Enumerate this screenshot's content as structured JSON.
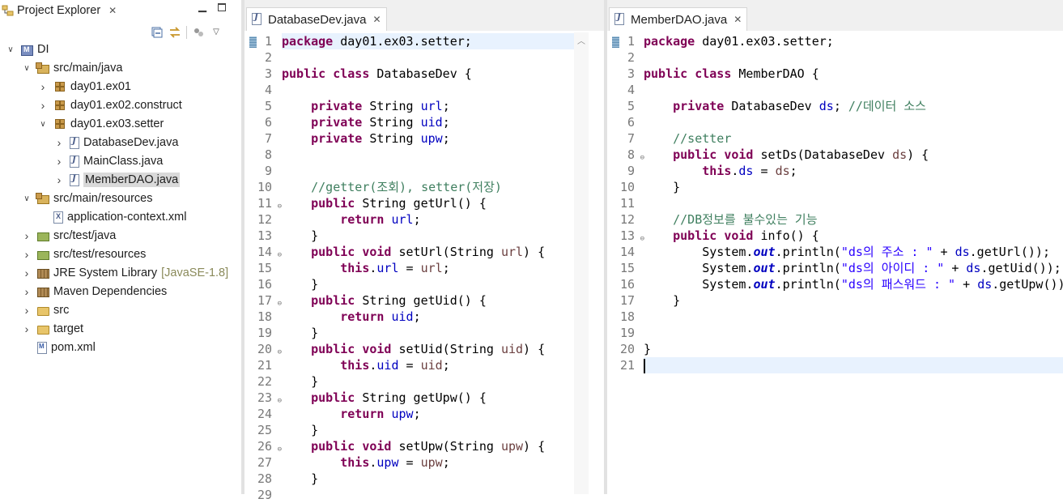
{
  "explorer": {
    "title": "Project Explorer",
    "tree": [
      {
        "label": "DI",
        "icon": "maven-project-icon",
        "twisty": "expanded",
        "level": 0
      },
      {
        "label": "src/main/java",
        "icon": "source-folder-icon",
        "twisty": "expanded",
        "level": 1
      },
      {
        "label": "day01.ex01",
        "icon": "package-icon",
        "twisty": "collapsed",
        "level": 2
      },
      {
        "label": "day01.ex02.construct",
        "icon": "package-icon",
        "twisty": "collapsed",
        "level": 2
      },
      {
        "label": "day01.ex03.setter",
        "icon": "package-icon",
        "twisty": "expanded",
        "level": 2
      },
      {
        "label": "DatabaseDev.java",
        "icon": "java-file-icon",
        "twisty": "collapsed",
        "level": 3
      },
      {
        "label": "MainClass.java",
        "icon": "java-file-icon",
        "twisty": "collapsed",
        "level": 3
      },
      {
        "label": "MemberDAO.java",
        "icon": "java-file-icon",
        "twisty": "collapsed",
        "level": 3,
        "selected": true
      },
      {
        "label": "src/main/resources",
        "icon": "source-folder-icon",
        "twisty": "expanded",
        "level": 1
      },
      {
        "label": "application-context.xml",
        "icon": "xml-file-icon",
        "twisty": "none",
        "level": 2
      },
      {
        "label": "src/test/java",
        "icon": "test-folder-icon",
        "twisty": "collapsed",
        "level": 1
      },
      {
        "label": "src/test/resources",
        "icon": "test-folder-icon",
        "twisty": "collapsed",
        "level": 1
      },
      {
        "label": "JRE System Library",
        "decoration": "[JavaSE-1.8]",
        "icon": "library-icon",
        "twisty": "collapsed",
        "level": 1
      },
      {
        "label": "Maven Dependencies",
        "icon": "library-icon",
        "twisty": "collapsed",
        "level": 1
      },
      {
        "label": "src",
        "icon": "folder-icon",
        "twisty": "collapsed",
        "level": 1
      },
      {
        "label": "target",
        "icon": "folder-icon",
        "twisty": "collapsed",
        "level": 1
      },
      {
        "label": "pom.xml",
        "icon": "maven-file-icon",
        "twisty": "none",
        "level": 1
      }
    ]
  },
  "editor1": {
    "tab_label": "DatabaseDev.java",
    "line_numbers": [
      "1",
      "2",
      "3",
      "4",
      "5",
      "6",
      "7",
      "8",
      "9",
      "10",
      "11",
      "12",
      "13",
      "14",
      "15",
      "16",
      "17",
      "18",
      "19",
      "20",
      "21",
      "22",
      "23",
      "24",
      "25",
      "26",
      "27",
      "28",
      "29"
    ],
    "folds": [
      "11",
      "14",
      "17",
      "20",
      "23",
      "26"
    ],
    "lines": [
      [
        {
          "t": "package",
          "c": "kw"
        },
        {
          "t": " day01.ex03.setter;"
        }
      ],
      [],
      [
        {
          "t": "public",
          "c": "kw"
        },
        {
          "t": " "
        },
        {
          "t": "class",
          "c": "kw"
        },
        {
          "t": " DatabaseDev {"
        }
      ],
      [],
      [
        {
          "t": "    "
        },
        {
          "t": "private",
          "c": "kw"
        },
        {
          "t": " String "
        },
        {
          "t": "url",
          "c": "fld"
        },
        {
          "t": ";"
        }
      ],
      [
        {
          "t": "    "
        },
        {
          "t": "private",
          "c": "kw"
        },
        {
          "t": " String "
        },
        {
          "t": "uid",
          "c": "fld"
        },
        {
          "t": ";"
        }
      ],
      [
        {
          "t": "    "
        },
        {
          "t": "private",
          "c": "kw"
        },
        {
          "t": " String "
        },
        {
          "t": "upw",
          "c": "fld"
        },
        {
          "t": ";"
        }
      ],
      [],
      [],
      [
        {
          "t": "    "
        },
        {
          "t": "//getter(조회), setter(저장)",
          "c": "cm"
        }
      ],
      [
        {
          "t": "    "
        },
        {
          "t": "public",
          "c": "kw"
        },
        {
          "t": " String getUrl() {"
        }
      ],
      [
        {
          "t": "        "
        },
        {
          "t": "return",
          "c": "kw"
        },
        {
          "t": " "
        },
        {
          "t": "url",
          "c": "fld"
        },
        {
          "t": ";"
        }
      ],
      [
        {
          "t": "    }"
        }
      ],
      [
        {
          "t": "    "
        },
        {
          "t": "public",
          "c": "kw"
        },
        {
          "t": " "
        },
        {
          "t": "void",
          "c": "kw"
        },
        {
          "t": " setUrl(String "
        },
        {
          "t": "url",
          "c": "vr"
        },
        {
          "t": ") {"
        }
      ],
      [
        {
          "t": "        "
        },
        {
          "t": "this",
          "c": "kw"
        },
        {
          "t": "."
        },
        {
          "t": "url",
          "c": "fld"
        },
        {
          "t": " = "
        },
        {
          "t": "url",
          "c": "vr"
        },
        {
          "t": ";"
        }
      ],
      [
        {
          "t": "    }"
        }
      ],
      [
        {
          "t": "    "
        },
        {
          "t": "public",
          "c": "kw"
        },
        {
          "t": " String getUid() {"
        }
      ],
      [
        {
          "t": "        "
        },
        {
          "t": "return",
          "c": "kw"
        },
        {
          "t": " "
        },
        {
          "t": "uid",
          "c": "fld"
        },
        {
          "t": ";"
        }
      ],
      [
        {
          "t": "    }"
        }
      ],
      [
        {
          "t": "    "
        },
        {
          "t": "public",
          "c": "kw"
        },
        {
          "t": " "
        },
        {
          "t": "void",
          "c": "kw"
        },
        {
          "t": " setUid(String "
        },
        {
          "t": "uid",
          "c": "vr"
        },
        {
          "t": ") {"
        }
      ],
      [
        {
          "t": "        "
        },
        {
          "t": "this",
          "c": "kw"
        },
        {
          "t": "."
        },
        {
          "t": "uid",
          "c": "fld"
        },
        {
          "t": " = "
        },
        {
          "t": "uid",
          "c": "vr"
        },
        {
          "t": ";"
        }
      ],
      [
        {
          "t": "    }"
        }
      ],
      [
        {
          "t": "    "
        },
        {
          "t": "public",
          "c": "kw"
        },
        {
          "t": " String getUpw() {"
        }
      ],
      [
        {
          "t": "        "
        },
        {
          "t": "return",
          "c": "kw"
        },
        {
          "t": " "
        },
        {
          "t": "upw",
          "c": "fld"
        },
        {
          "t": ";"
        }
      ],
      [
        {
          "t": "    }"
        }
      ],
      [
        {
          "t": "    "
        },
        {
          "t": "public",
          "c": "kw"
        },
        {
          "t": " "
        },
        {
          "t": "void",
          "c": "kw"
        },
        {
          "t": " setUpw(String "
        },
        {
          "t": "upw",
          "c": "vr"
        },
        {
          "t": ") {"
        }
      ],
      [
        {
          "t": "        "
        },
        {
          "t": "this",
          "c": "kw"
        },
        {
          "t": "."
        },
        {
          "t": "upw",
          "c": "fld"
        },
        {
          "t": " = "
        },
        {
          "t": "upw",
          "c": "vr"
        },
        {
          "t": ";"
        }
      ],
      [
        {
          "t": "    }"
        }
      ],
      []
    ]
  },
  "editor2": {
    "tab_label": "MemberDAO.java",
    "line_numbers": [
      "1",
      "2",
      "3",
      "4",
      "5",
      "6",
      "7",
      "8",
      "9",
      "10",
      "11",
      "12",
      "13",
      "14",
      "15",
      "16",
      "17",
      "18",
      "19",
      "20",
      "21"
    ],
    "folds": [
      "8",
      "13"
    ],
    "lines": [
      [
        {
          "t": "package",
          "c": "kw"
        },
        {
          "t": " day01.ex03.setter;"
        }
      ],
      [],
      [
        {
          "t": "public",
          "c": "kw"
        },
        {
          "t": " "
        },
        {
          "t": "class",
          "c": "kw"
        },
        {
          "t": " MemberDAO {"
        }
      ],
      [],
      [
        {
          "t": "    "
        },
        {
          "t": "private",
          "c": "kw"
        },
        {
          "t": " DatabaseDev "
        },
        {
          "t": "ds",
          "c": "fld"
        },
        {
          "t": "; "
        },
        {
          "t": "//데이터 소스",
          "c": "cm"
        }
      ],
      [],
      [
        {
          "t": "    "
        },
        {
          "t": "//setter",
          "c": "cm"
        }
      ],
      [
        {
          "t": "    "
        },
        {
          "t": "public",
          "c": "kw"
        },
        {
          "t": " "
        },
        {
          "t": "void",
          "c": "kw"
        },
        {
          "t": " setDs(DatabaseDev "
        },
        {
          "t": "ds",
          "c": "vr"
        },
        {
          "t": ") {"
        }
      ],
      [
        {
          "t": "        "
        },
        {
          "t": "this",
          "c": "kw"
        },
        {
          "t": "."
        },
        {
          "t": "ds",
          "c": "fld"
        },
        {
          "t": " = "
        },
        {
          "t": "ds",
          "c": "vr"
        },
        {
          "t": ";"
        }
      ],
      [
        {
          "t": "    }"
        }
      ],
      [],
      [
        {
          "t": "    "
        },
        {
          "t": "//DB정보를 불수있는 기능",
          "c": "cm"
        }
      ],
      [
        {
          "t": "    "
        },
        {
          "t": "public",
          "c": "kw"
        },
        {
          "t": " "
        },
        {
          "t": "void",
          "c": "kw"
        },
        {
          "t": " info() {"
        }
      ],
      [
        {
          "t": "        System."
        },
        {
          "t": "out",
          "c": "sf"
        },
        {
          "t": ".println("
        },
        {
          "t": "\"ds의 주소 : \"",
          "c": "st"
        },
        {
          "t": " + "
        },
        {
          "t": "ds",
          "c": "fld"
        },
        {
          "t": ".getUrl());"
        }
      ],
      [
        {
          "t": "        System."
        },
        {
          "t": "out",
          "c": "sf"
        },
        {
          "t": ".println("
        },
        {
          "t": "\"ds의 아이디 : \"",
          "c": "st"
        },
        {
          "t": " + "
        },
        {
          "t": "ds",
          "c": "fld"
        },
        {
          "t": ".getUid());"
        }
      ],
      [
        {
          "t": "        System."
        },
        {
          "t": "out",
          "c": "sf"
        },
        {
          "t": ".println("
        },
        {
          "t": "\"ds의 패스워드 : \"",
          "c": "st"
        },
        {
          "t": " + "
        },
        {
          "t": "ds",
          "c": "fld"
        },
        {
          "t": ".getUpw());"
        }
      ],
      [
        {
          "t": "    }"
        }
      ],
      [],
      [],
      [
        {
          "t": "}"
        }
      ],
      []
    ]
  }
}
